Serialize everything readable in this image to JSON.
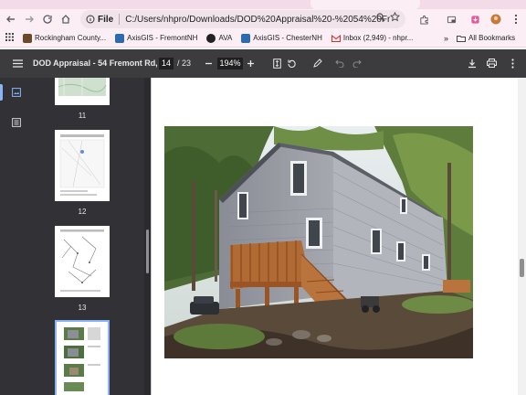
{
  "browser": {
    "address_scheme": "File",
    "url": "C:/Users/nhpro/Downloads/DOD%20Appraisal%20-%2054%20Fremont%20Rd,%...",
    "bookmarks": [
      {
        "label": "Rockingham County...",
        "color": "#6b4a2a"
      },
      {
        "label": "AxisGIS - FremontNH",
        "color": "#2b6cb0"
      },
      {
        "label": "AVA",
        "color": "#222222"
      },
      {
        "label": "AxisGIS - ChesterNH",
        "color": "#2b6cb0"
      },
      {
        "label": "Inbox (2,949) - nhpr...",
        "color": "#d93025"
      }
    ],
    "all_bookmarks": "All Bookmarks"
  },
  "pdf": {
    "title": "DOD Appraisal - 54 Fremont Rd, C...",
    "current_page": "14",
    "total_pages": "/ 23",
    "zoom": "194%"
  },
  "thumbnails": [
    {
      "page": "11"
    },
    {
      "page": "12"
    },
    {
      "page": "13"
    },
    {
      "page": "14",
      "selected": true
    }
  ],
  "colors": {
    "pdf_toolbar": "#3c3c3f",
    "sidebar": "#323236",
    "selected_thumb_border": "#8ab4f8",
    "browser_chrome": "#fbeef5"
  }
}
